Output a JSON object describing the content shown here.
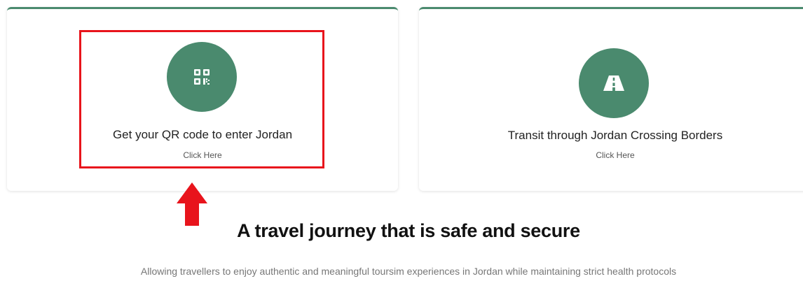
{
  "accent_color": "#4a8a6e",
  "highlight_color": "#e8141c",
  "cards": [
    {
      "icon": "qr-code-icon",
      "title": "Get your QR code to enter Jordan",
      "link": "Click Here"
    },
    {
      "icon": "road-icon",
      "title": "Transit through Jordan Crossing Borders",
      "link": "Click Here"
    }
  ],
  "section": {
    "headline": "A travel journey that is safe and secure",
    "subtext": "Allowing travellers to enjoy authentic and meaningful toursim experiences in Jordan while maintaining strict health protocols"
  }
}
